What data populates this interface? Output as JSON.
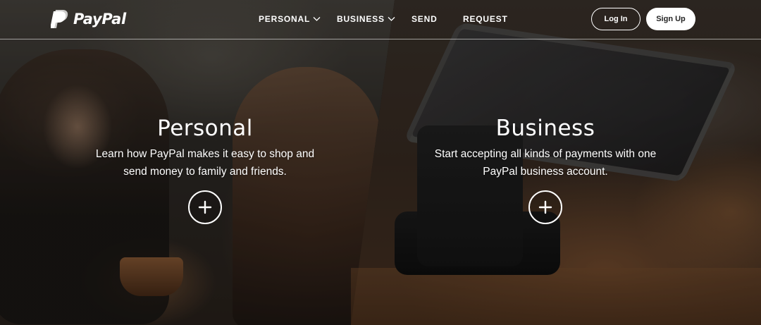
{
  "brand": {
    "name": "PayPal"
  },
  "nav": {
    "items": [
      {
        "label": "PERSONAL",
        "has_dropdown": true
      },
      {
        "label": "BUSINESS",
        "has_dropdown": true
      },
      {
        "label": "SEND",
        "has_dropdown": false
      },
      {
        "label": "REQUEST",
        "has_dropdown": false
      }
    ],
    "login_label": "Log In",
    "signup_label": "Sign Up"
  },
  "panels": {
    "personal": {
      "title": "Personal",
      "description": "Learn how PayPal makes it easy to shop and send money to family and friends."
    },
    "business": {
      "title": "Business",
      "description": "Start accepting all kinds of payments with one PayPal business account."
    }
  },
  "colors": {
    "text": "#ffffff",
    "signup_bg": "#ffffff",
    "signup_text": "#222222"
  },
  "icons": {
    "logo": "paypal-logo-icon",
    "dropdown": "chevron-down-icon",
    "expand": "plus-circle-icon"
  }
}
